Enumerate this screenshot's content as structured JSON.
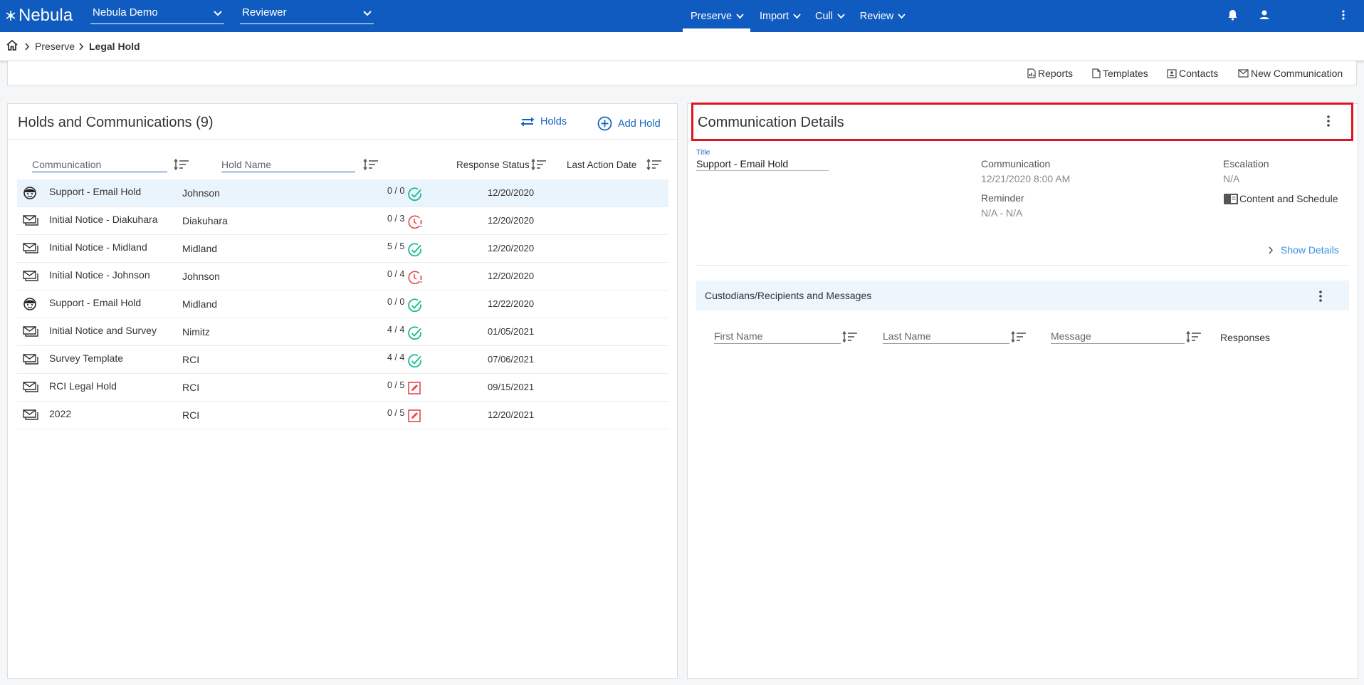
{
  "app": {
    "logo_text": "Nebula",
    "project_select": "Nebula Demo",
    "role_select": "Reviewer",
    "nav": [
      "Preserve",
      "Import",
      "Cull",
      "Review"
    ]
  },
  "breadcrumb": {
    "items": [
      "Preserve",
      "Legal Hold"
    ]
  },
  "toolbar": {
    "reports": "Reports",
    "templates": "Templates",
    "contacts": "Contacts",
    "new_communication": "New Communication"
  },
  "holds": {
    "title": "Holds and Communications (9)",
    "holds_button": "Holds",
    "add_hold_button": "Add Hold",
    "columns": {
      "communication": "Communication",
      "hold_name": "Hold Name",
      "response_status": "Response Status",
      "last_action_date": "Last Action Date"
    },
    "rows": [
      {
        "type": "support",
        "communication": "Support - Email Hold",
        "hold": "Johnson",
        "status": "complete",
        "response": "0 / 0",
        "date": "12/20/2020",
        "selected": true
      },
      {
        "type": "email",
        "communication": "Initial Notice - Diakuhara",
        "hold": "Diakuhara",
        "status": "overdue",
        "response": "0 / 3",
        "date": "12/20/2020",
        "selected": false
      },
      {
        "type": "email",
        "communication": "Initial Notice - Midland",
        "hold": "Midland",
        "status": "complete",
        "response": "5 / 5",
        "date": "12/20/2020",
        "selected": false
      },
      {
        "type": "email",
        "communication": "Initial Notice - Johnson",
        "hold": "Johnson",
        "status": "overdue",
        "response": "0 / 4",
        "date": "12/20/2020",
        "selected": false
      },
      {
        "type": "support",
        "communication": "Support - Email Hold",
        "hold": "Midland",
        "status": "complete",
        "response": "0 / 0",
        "date": "12/22/2020",
        "selected": false
      },
      {
        "type": "email",
        "communication": "Initial Notice and Survey",
        "hold": "Nimitz",
        "status": "complete",
        "response": "4 / 4",
        "date": "01/05/2021",
        "selected": false
      },
      {
        "type": "email",
        "communication": "Survey Template",
        "hold": "RCI",
        "status": "complete",
        "response": "4 / 4",
        "date": "07/06/2021",
        "selected": false
      },
      {
        "type": "email",
        "communication": "RCI Legal Hold",
        "hold": "RCI",
        "status": "draft",
        "response": "0 / 5",
        "date": "09/15/2021",
        "selected": false
      },
      {
        "type": "email",
        "communication": "2022",
        "hold": "RCI",
        "status": "draft",
        "response": "0 / 5",
        "date": "12/20/2021",
        "selected": false
      }
    ]
  },
  "details": {
    "title": "Communication Details",
    "title_label": "Title",
    "title_value": "Support - Email Hold",
    "communication_label": "Communication",
    "communication_value": "12/21/2020 8:00 AM",
    "reminder_label": "Reminder",
    "reminder_value": "N/A - N/A",
    "escalation_label": "Escalation",
    "escalation_value": "N/A",
    "content_schedule": "Content and Schedule",
    "show_details": "Show Details",
    "custodians_title": "Custodians/Recipients and Messages",
    "columns": {
      "first_name": "First Name",
      "last_name": "Last Name",
      "message": "Message",
      "responses": "Responses"
    }
  },
  "colors": {
    "brand_blue": "#0f5bbf",
    "link_blue": "#1565c0",
    "status_green": "#17b890",
    "status_red": "#e5484d",
    "highlight_red": "#e0141e"
  }
}
